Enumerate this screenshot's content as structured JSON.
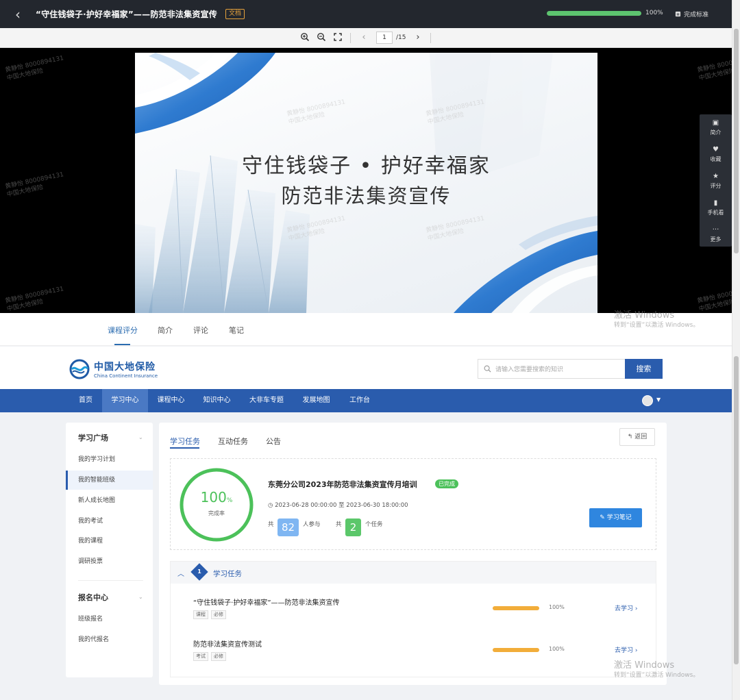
{
  "topbar": {
    "title": "“守住钱袋子·护好幸福家”——防范非法集资宣传",
    "tag": "文档",
    "progress_value": 100,
    "progress_text": "100%",
    "finish_label": "完成标准"
  },
  "viewer": {
    "page_current": "1",
    "page_total": "/15",
    "slide_title_line1": "守住钱袋子 • 护好幸福家",
    "slide_title_line2": "防范非法集资宣传",
    "watermark_line1": "黄静怡 8000894131",
    "watermark_line2": "中国大地保险",
    "side_tools": [
      {
        "icon": "info-icon",
        "label": "简介"
      },
      {
        "icon": "heart-icon",
        "label": "收藏"
      },
      {
        "icon": "star-icon",
        "label": "评分"
      },
      {
        "icon": "mobile-icon",
        "label": "手机看"
      },
      {
        "icon": "more-icon",
        "label": "更多"
      }
    ]
  },
  "course_tabs": [
    "课程评分",
    "简介",
    "评论",
    "笔记"
  ],
  "windows_activation": {
    "line1": "激活 Windows",
    "line2": "转到“设置”以激活 Windows。"
  },
  "site": {
    "logo_cn": "中国大地保险",
    "logo_en": "China Continent Insurance",
    "search_placeholder": "请输入您需要搜索的知识",
    "search_button": "搜索",
    "nav": [
      "首页",
      "学习中心",
      "课程中心",
      "知识中心",
      "大非车专题",
      "发展地图",
      "工作台"
    ]
  },
  "sidebar": {
    "group1_title": "学习广场",
    "group1_items": [
      "我的学习计划",
      "我的智能班级",
      "新人成长地图",
      "我的考试",
      "我的课程",
      "调研投票"
    ],
    "group2_title": "报名中心",
    "group2_items": [
      "班级报名",
      "我的代报名"
    ]
  },
  "main": {
    "tabs": [
      "学习任务",
      "互动任务",
      "公告"
    ],
    "back_label": "返回",
    "ring_pct": "100",
    "ring_unit": "%",
    "ring_label": "完成率",
    "task_title": "东莞分公司2023年防范非法集资宣传月培训",
    "status": "已完成",
    "date_range": "2023-06-28 00:00:00 至 2023-06-30 18:00:00",
    "stat_prefix": "共",
    "participants": "82",
    "participants_suffix": "人参与",
    "tasks_count": "2",
    "tasks_suffix": "个任务",
    "note_button": "学习笔记",
    "section_num": "1",
    "section_title": "学习任务",
    "tasks": [
      {
        "title": "“守住钱袋子·护好幸福家”——防范非法集资宣传",
        "tag1": "课程",
        "tag2": "必修",
        "progress_value": 100,
        "progress": "100%",
        "action": "去学习 ›"
      },
      {
        "title": "防范非法集资宣传测试",
        "tag1": "考试",
        "tag2": "必修",
        "progress_value": 100,
        "progress": "100%",
        "action": "去学习 ›"
      }
    ]
  },
  "colors": {
    "brand": "#2a5cad",
    "success": "#4cc15a",
    "warning": "#f2ad3a"
  }
}
